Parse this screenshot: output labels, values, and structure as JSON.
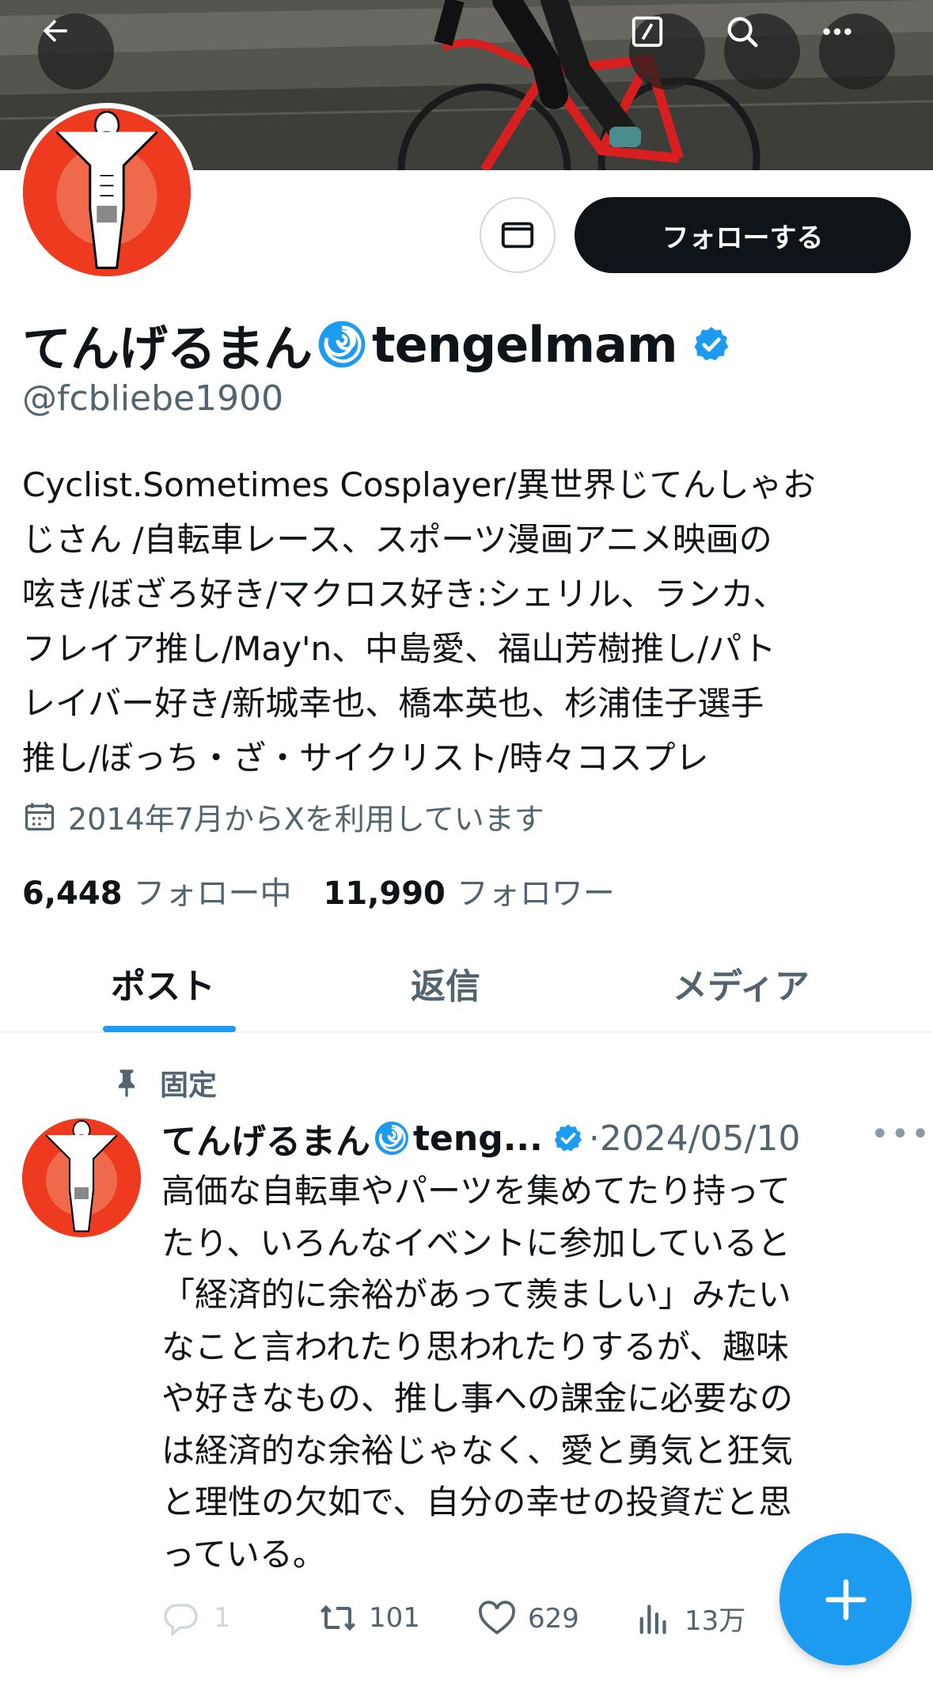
{
  "profile": {
    "name": "てんげるまん🌀tengelmam",
    "name_text": "てんげるまん",
    "name_latin": "tengelmam",
    "handle": "@fcbliebe1900",
    "verified": true,
    "bio": "Cyclist.Sometimes Cosplayer/異世界じてんしゃおじさん /自転車レース、スポーツ漫画アニメ映画の呟き/ぼざろ好き/マクロス好き:シェリル、ランカ、フレイア推し/May'n、中島愛、福山芳樹推し/パトレイバー好き/新城幸也、橋本英也、杉浦佳子選手推し/ぼっち・ざ・サイクリスト/時々コスプレ",
    "bio_lines": [
      "Cyclist.Sometimes Cosplayer/異世界じてんしゃお",
      "じさん /自転車レース、スポーツ漫画アニメ映画の",
      "呟き/ぼざろ好き/マクロス好き:シェリル、ランカ、",
      "フレイア推し/May'n、中島愛、福山芳樹推し/パト",
      "レイバー好き/新城幸也、橋本英也、杉浦佳子選手",
      "推し/ぼっち・ざ・サイクリスト/時々コスプレ"
    ],
    "joined": "2014年7月からXを利用しています",
    "following_count": "6,448",
    "following_label": "フォロー中",
    "followers_count": "11,990",
    "followers_label": "フォロワー"
  },
  "header": {
    "back_icon": "arrow-left-icon",
    "edit_icon": "compose-slash-icon",
    "search_icon": "search-icon",
    "more_icon": "more-horizontal-icon"
  },
  "actions": {
    "message_icon": "envelope-icon",
    "follow_label": "フォローする"
  },
  "tabs": [
    {
      "label": "ポスト",
      "active": true
    },
    {
      "label": "返信",
      "active": false
    },
    {
      "label": "メディア",
      "active": false
    }
  ],
  "pinned_tweet": {
    "pinned_label": "固定",
    "author_name": "てんげるまん🌀teng...",
    "author_name_text": "てんげるまん",
    "author_name_latin": "teng...",
    "date": "·2024/05/10",
    "text_lines": [
      "高価な自転車やパーツを集めてたり持って",
      "たり、いろんなイベントに参加していると",
      "「経済的に余裕があって羨ましい」みたい",
      "なこと言われたり思われたりするが、趣味",
      "や好きなもの、推し事への課金に必要なの",
      "は経済的な余裕じゃなく、愛と勇気と狂気",
      "と理性の欠如で、自分の幸せの投資だと思",
      "っている。"
    ],
    "text": "高価な自転車やパーツを集めてたり持ってたり、いろんなイベントに参加していると「経済的に余裕があって羨ましい」みたいなこと言われたり思われたりするが、趣味や好きなもの、推し事への課金に必要なのは経済的な余裕じゃなく、愛と勇気と狂気と理性の欠如で、自分の幸せの投資だと思っている。",
    "replies": "1",
    "reposts": "101",
    "likes": "629",
    "views": "13万"
  },
  "colors": {
    "accent": "#1d9bf0",
    "text_primary": "#0f1419",
    "text_secondary": "#536471",
    "avatar_bg": "#ee3a1f"
  }
}
